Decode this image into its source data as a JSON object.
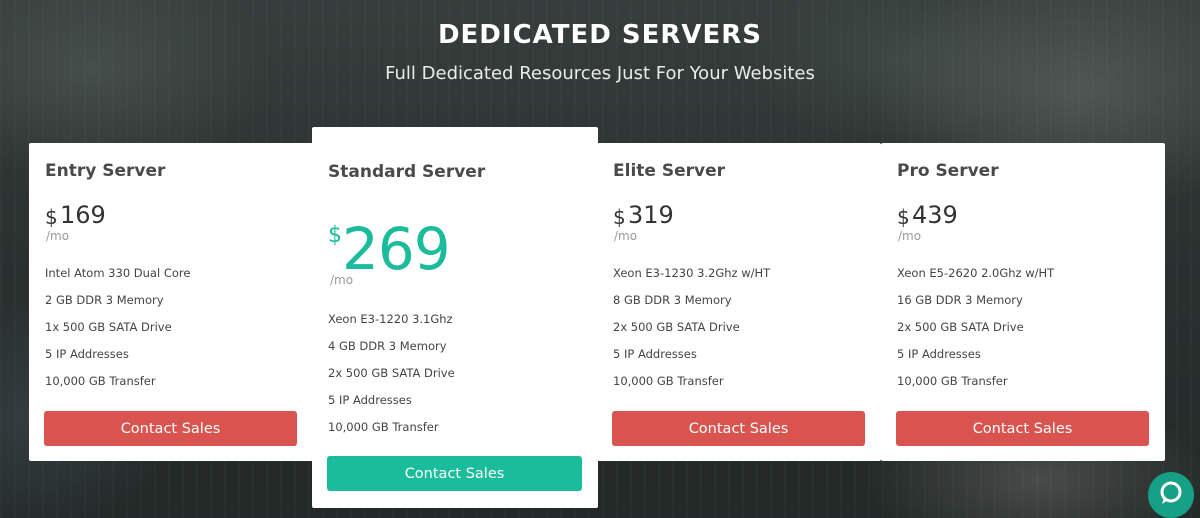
{
  "header": {
    "title": "DEDICATED SERVERS",
    "subtitle": "Full Dedicated Resources Just For Your Websites"
  },
  "plans": [
    {
      "name": "Entry Server",
      "currency": "$",
      "price": "169",
      "period": "/mo",
      "features": [
        "Intel Atom 330 Dual Core",
        "2 GB DDR 3 Memory",
        "1x 500 GB SATA Drive",
        "5 IP Addresses",
        "10,000 GB Transfer"
      ],
      "button": "Contact Sales"
    },
    {
      "name": "Standard Server",
      "currency": "$",
      "price": "269",
      "period": "/mo",
      "features": [
        "Xeon E3-1220 3.1Ghz",
        "4 GB DDR 3 Memory",
        "2x 500 GB SATA Drive",
        "5 IP Addresses",
        "10,000 GB Transfer"
      ],
      "button": "Contact Sales"
    },
    {
      "name": "Elite Server",
      "currency": "$",
      "price": "319",
      "period": "/mo",
      "features": [
        "Xeon E3-1230 3.2Ghz w/HT",
        "8 GB DDR 3 Memory",
        "2x 500 GB SATA Drive",
        "5 IP Addresses",
        "10,000 GB Transfer"
      ],
      "button": "Contact Sales"
    },
    {
      "name": "Pro Server",
      "currency": "$",
      "price": "439",
      "period": "/mo",
      "features": [
        "Xeon E5-2620 2.0Ghz w/HT",
        "16 GB DDR 3 Memory",
        "2x 500 GB SATA Drive",
        "5 IP Addresses",
        "10,000 GB Transfer"
      ],
      "button": "Contact Sales"
    }
  ],
  "colors": {
    "accent_teal": "#1abc9c",
    "button_red": "#d9534f",
    "chat_green": "#16a085"
  },
  "chat": {
    "icon": "chat-bubble-icon"
  }
}
